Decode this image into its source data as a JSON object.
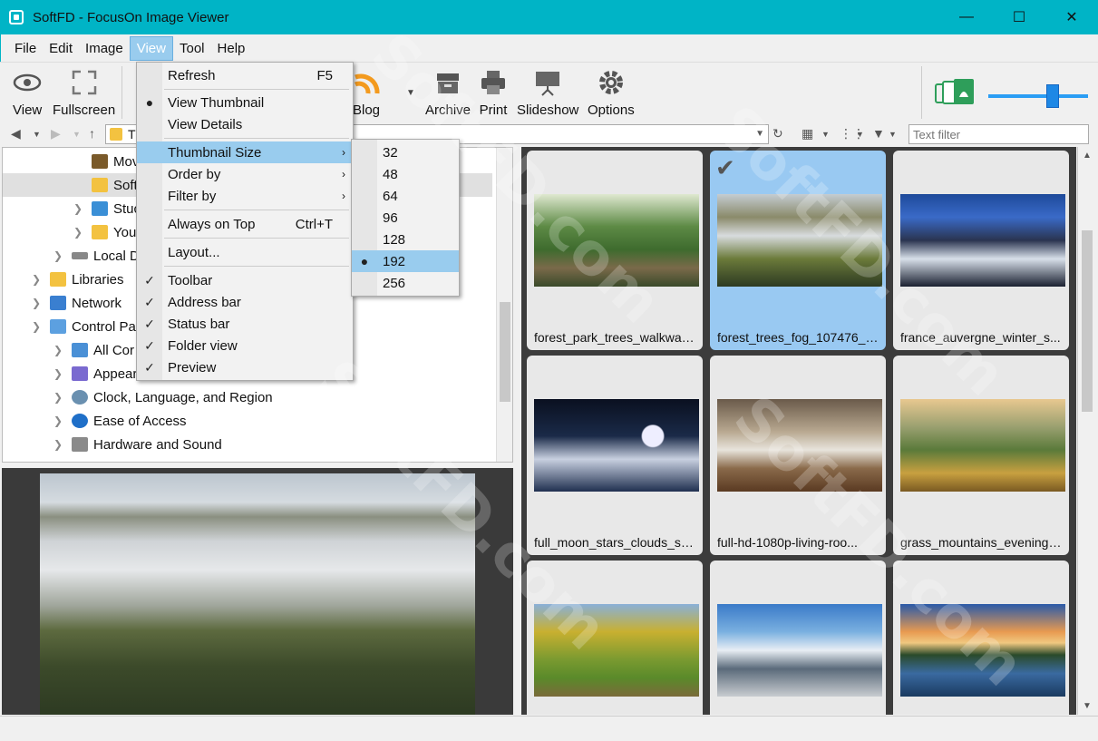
{
  "window": {
    "title": "SoftFD - FocusOn Image Viewer"
  },
  "menubar": [
    "File",
    "Edit",
    "Image",
    "View",
    "Tool",
    "Help"
  ],
  "toolbar": {
    "buttons": [
      "View",
      "Fullscreen",
      "Blog",
      "Archive",
      "Print",
      "Slideshow",
      "Options"
    ],
    "zoom_level": 0.6
  },
  "address": {
    "filter_placeholder": "Text filter",
    "path_initial": "T"
  },
  "tree": {
    "items": [
      "Mov",
      "Soft",
      "Stuc",
      "You",
      "Local D",
      "Libraries",
      "Network",
      "Control Par",
      "All Cor",
      "Appear",
      "Clock, Language, and Region",
      "Ease of Access",
      "Hardware and Sound"
    ]
  },
  "view_menu": {
    "items": [
      {
        "label": "Refresh",
        "shortcut": "F5"
      },
      {
        "label": "View Thumbnail",
        "mark": "●"
      },
      {
        "label": "View Details"
      },
      {
        "label": "Thumbnail Size",
        "arrow": "›"
      },
      {
        "label": "Order by",
        "arrow": "›"
      },
      {
        "label": "Filter by",
        "arrow": "›"
      },
      {
        "label": "Always on Top",
        "shortcut": "Ctrl+T"
      },
      {
        "label": "Layout..."
      },
      {
        "label": "Toolbar",
        "mark": "✓"
      },
      {
        "label": "Address bar",
        "mark": "✓"
      },
      {
        "label": "Status bar",
        "mark": "✓"
      },
      {
        "label": "Folder view",
        "mark": "✓"
      },
      {
        "label": "Preview",
        "mark": "✓"
      }
    ]
  },
  "size_menu": {
    "items": [
      "32",
      "48",
      "64",
      "96",
      "128",
      "192",
      "256"
    ],
    "selected_mark": "●"
  },
  "thumbnails": [
    "forest_park_trees_walkway...",
    "forest_trees_fog_107476_1...",
    "france_auvergne_winter_s...",
    "full_moon_stars_clouds_sh...",
    "full-hd-1080p-living-roo...",
    "grass_mountains_evening_...",
    "",
    "",
    ""
  ],
  "watermark": "SoftFD.com"
}
